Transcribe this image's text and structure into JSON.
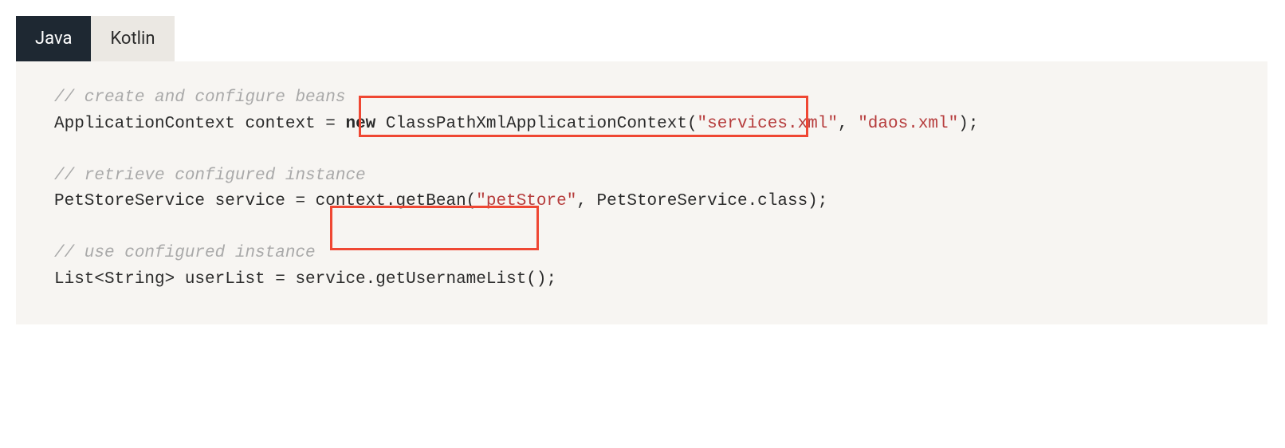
{
  "tabs": {
    "java": "Java",
    "kotlin": "Kotlin"
  },
  "code": {
    "line1_comment": "// create and configure beans",
    "line2_pre": "ApplicationContext context = ",
    "line2_new": "new",
    "line2_class": " ClassPathXmlApplicationContext(",
    "line2_str1": "\"services.xml\"",
    "line2_sep": ", ",
    "line2_str2": "\"daos.xml\"",
    "line2_end": ");",
    "line3_comment": "// retrieve configured instance",
    "line4_pre": "PetStoreService service = context.getBean(",
    "line4_str": "\"petStore\"",
    "line4_end": ", PetStoreService.class);",
    "line5_comment": "// use configured instance",
    "line6": "List<String> userList = service.getUsernameList();"
  },
  "highlights": {
    "box1_desc": "new ClassPathXmlApplicationContext(",
    "box2_desc": "context.getBean("
  }
}
